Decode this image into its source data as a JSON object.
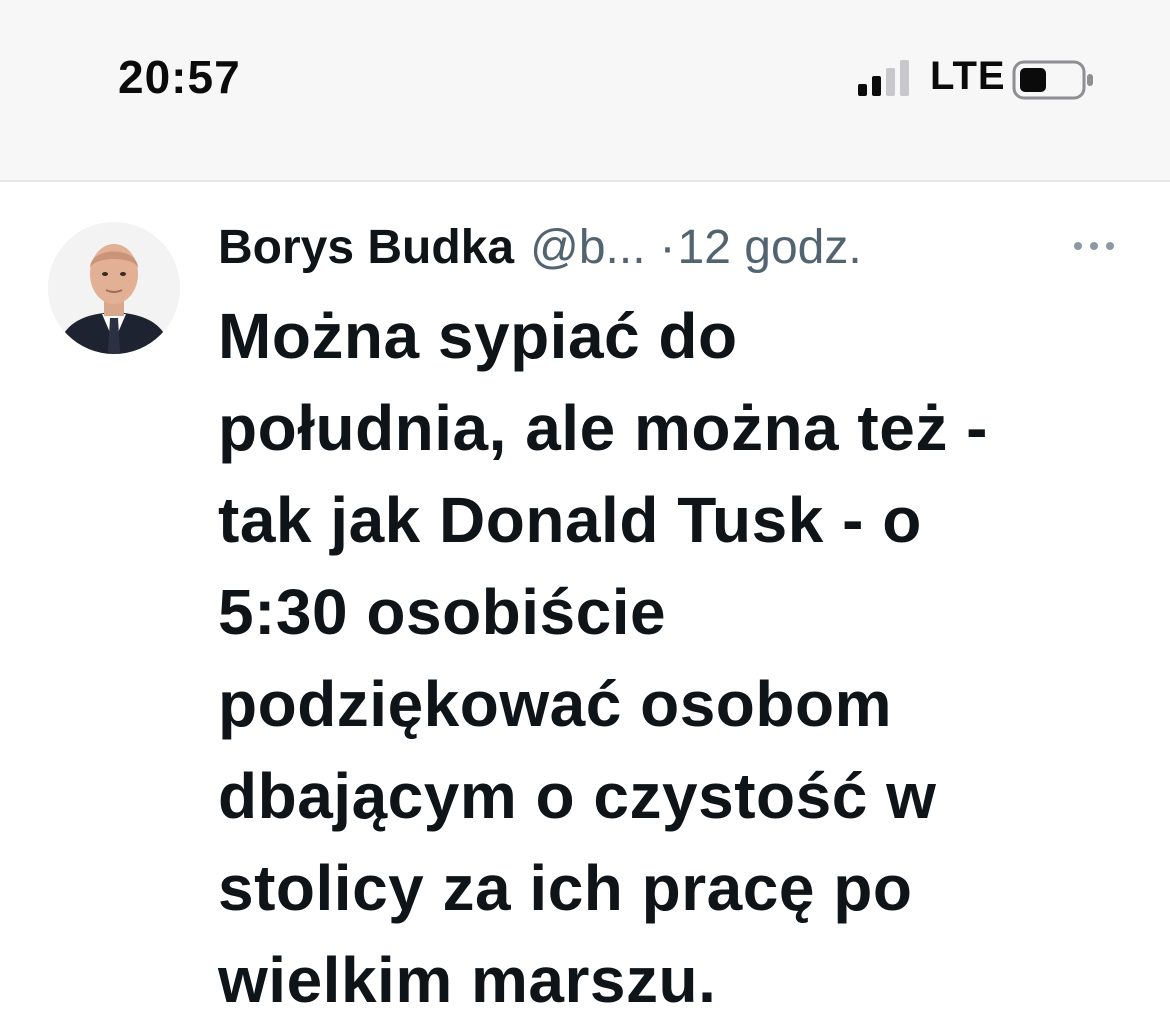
{
  "status_bar": {
    "time": "20:57",
    "network": "LTE",
    "signal_icon": "cellular-signal-icon",
    "battery_icon": "battery-icon",
    "signal_bars_active": 2,
    "signal_bars_total": 4,
    "battery_level": 0.4
  },
  "tweet": {
    "author_name": "Borys Budka",
    "author_handle": "@b...",
    "separator": "·",
    "time_ago": "12 godz.",
    "avatar_icon": "avatar",
    "more_icon": "more-dots-icon",
    "text_lines": [
      "Można sypiać do",
      "południa, ale można też -",
      "tak jak Donald Tusk - o",
      "5:30 osobiście",
      "podziękować osobom",
      "dbającym o czystość w",
      "stolicy za ich pracę po",
      "wielkim marszu."
    ]
  },
  "colors": {
    "text_primary": "#0f1419",
    "text_secondary": "#536471",
    "status_bar_bg": "#f7f7f8"
  }
}
